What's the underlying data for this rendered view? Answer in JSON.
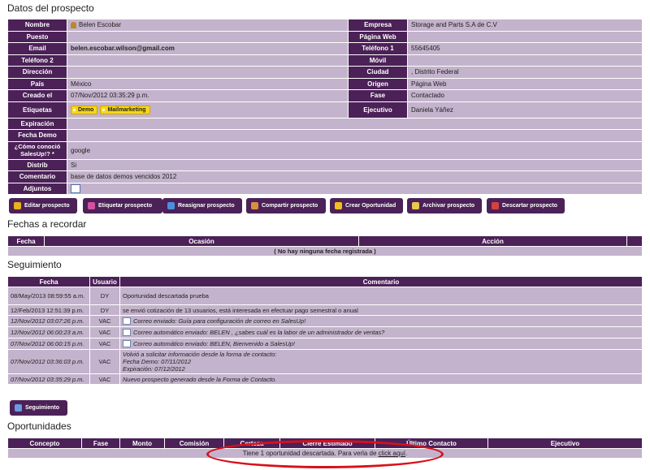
{
  "titles": {
    "datos": "Datos del prospecto",
    "fechas": "Fechas a recordar",
    "seguimiento": "Seguimiento",
    "oportunidades": "Oportunidades"
  },
  "prospect": {
    "nombre_label": "Nombre",
    "nombre": "Belen Escobar",
    "empresa_label": "Empresa",
    "empresa": "Storage and Parts S.A de C.V",
    "puesto_label": "Puesto",
    "puesto": "",
    "pagina_label": "Página Web",
    "pagina": "",
    "email_label": "Email",
    "email": "belen.escobar.wilson@gmail.com",
    "tel1_label": "Teléfono 1",
    "tel1": "55645405",
    "tel2_label": "Teléfono 2",
    "tel2": "",
    "movil_label": "Móvil",
    "movil": "",
    "direccion_label": "Dirección",
    "direccion": "",
    "ciudad_label": "Ciudad",
    "ciudad": ", Distrito Federal",
    "pais_label": "País",
    "pais": "México",
    "origen_label": "Origen",
    "origen": "Página Web",
    "creado_label": "Creado el",
    "creado": "07/Nov/2012 03:35:29 p.m.",
    "fase_label": "Fase",
    "fase": "Contactado",
    "etiquetas_label": "Etiquetas",
    "tag1": "Demo",
    "tag2": "Mailmarketing",
    "ejecutivo_label": "Ejecutivo",
    "ejecutivo": "Daniela Yáñez",
    "expiracion_label": "Expiración",
    "expiracion": "",
    "fechademo_label": "Fecha Demo",
    "fechademo": "",
    "conocio_label": "¿Cómo conoció SalesUp!? *",
    "conocio": "google",
    "distrib_label": "Distrib",
    "distrib": "Si",
    "comentario_label": "Comentario",
    "comentario": "base de datos demos vencidos 2012",
    "adjuntos_label": "Adjuntos"
  },
  "buttons": [
    {
      "label": "Editar prospecto",
      "icon": "pencil-icon"
    },
    {
      "label": "Etiquetar prospecto",
      "icon": "tag-icon"
    },
    {
      "label": "Reasignar prospecto",
      "icon": "arrow-icon"
    },
    {
      "label": "Compartir prospecto",
      "icon": "share-icon"
    },
    {
      "label": "Crear Oportunidad",
      "icon": "star-icon"
    },
    {
      "label": "Archivar prospecto",
      "icon": "folder-icon"
    },
    {
      "label": "Descartar prospecto",
      "icon": "discard-icon"
    }
  ],
  "fechas": {
    "headers": [
      "Fecha",
      "Ocasión",
      "Acción"
    ],
    "empty": "( No hay ninguna fecha registrada )"
  },
  "seguimiento": {
    "headers": [
      "Fecha",
      "Usuario",
      "Comentario"
    ],
    "rows": [
      {
        "fecha": "08/May/2013 08:59:55 a.m.",
        "usuario": "DY",
        "comentario": "Oportunidad descartada prueba",
        "italic": false,
        "mail": false
      },
      {
        "fecha": "12/Feb/2013 12:51:39 p.m.",
        "usuario": "DY",
        "comentario": "se envió cotización de 13 usuarios, está interesada en efectuar pago semestral o anual",
        "italic": false,
        "mail": false
      },
      {
        "fecha": "12/Nov/2012 03:07:26 p.m.",
        "usuario": "VAC",
        "comentario": "Correo enviado: Guía para configuración de correo en SalesUp!",
        "italic": true,
        "mail": true
      },
      {
        "fecha": "12/Nov/2012 06:00:23 a.m.",
        "usuario": "VAC",
        "comentario": "Correo automático enviado: BELEN , ¿sabes cuál es la labor de un administrador de ventas?",
        "italic": true,
        "mail": true
      },
      {
        "fecha": "07/Nov/2012 06:00:15 p.m.",
        "usuario": "VAC",
        "comentario": "Correo automático enviado: BELEN, Bienvenido a SalesUp!",
        "italic": true,
        "mail": true
      },
      {
        "fecha": "07/Nov/2012 03:36:03 p.m.",
        "usuario": "VAC",
        "comentario": "Volvió a solicitar información desde la forma de contacto:",
        "c2": "Fecha Demo: 07/11/2012",
        "c3": "Expiración: 07/12/2012",
        "italic": true,
        "mail": false
      },
      {
        "fecha": "07/Nov/2012 03:35:29 p.m.",
        "usuario": "VAC",
        "comentario": "Nuevo prospecto generado desde la Forma de Contacto.",
        "italic": true,
        "mail": false
      }
    ],
    "button": "Seguimiento"
  },
  "oportunidades": {
    "headers": [
      "Concepto",
      "Fase",
      "Monto",
      "Comisión",
      "Certeza",
      "Cierre Estimado",
      "Último Contacto",
      "Ejecutivo"
    ],
    "notice": "Tiene 1 oportunidad descartada. Para verla de ",
    "link": "click aquí",
    "notice_end": "."
  },
  "colors": {
    "header": "#4b2157",
    "cell": "#c4b3cc",
    "highlight": "#d8101a"
  }
}
